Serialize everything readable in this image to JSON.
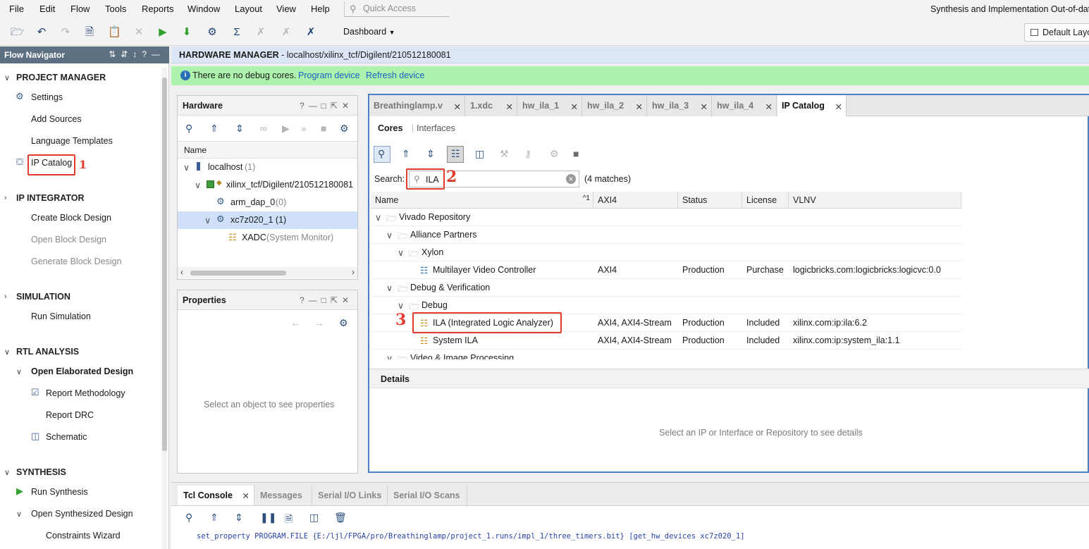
{
  "menu": [
    "File",
    "Edit",
    "Flow",
    "Tools",
    "Reports",
    "Window",
    "Layout",
    "View",
    "Help"
  ],
  "quick_access": {
    "placeholder": "Quick Access"
  },
  "window_status": "Synthesis and Implementation Out-of-date",
  "toolbar": {
    "dashboard_label": "Dashboard",
    "layout_label": "Default Layo"
  },
  "flow_navigator": {
    "title": "Flow Navigator",
    "sections": {
      "project_manager": "PROJECT MANAGER",
      "ip_integrator": "IP INTEGRATOR",
      "simulation": "SIMULATION",
      "rtl_analysis": "RTL ANALYSIS",
      "synthesis": "SYNTHESIS"
    },
    "items": {
      "settings": "Settings",
      "add_sources": "Add Sources",
      "language_templates": "Language Templates",
      "ip_catalog": "IP Catalog",
      "create_block_design": "Create Block Design",
      "open_block_design": "Open Block Design",
      "generate_block_design": "Generate Block Design",
      "run_simulation": "Run Simulation",
      "open_elaborated_design": "Open Elaborated Design",
      "report_methodology": "Report Methodology",
      "report_drc": "Report DRC",
      "schematic": "Schematic",
      "run_synthesis": "Run Synthesis",
      "open_synthesized_design": "Open Synthesized Design",
      "constraints_wizard": "Constraints Wizard"
    }
  },
  "annotations": {
    "one": "1",
    "two": "2",
    "three": "3"
  },
  "hardware_manager": {
    "title_bold": "HARDWARE MANAGER",
    "title_rest": " - localhost/xilinx_tcf/Digilent/210512180081",
    "info": "There are no debug cores.",
    "link_program": "Program device",
    "link_refresh": "Refresh device"
  },
  "hardware_panel": {
    "title": "Hardware",
    "col_name": "Name",
    "rows": {
      "localhost": "localhost",
      "localhost_count": " (1)",
      "target": "xilinx_tcf/Digilent/210512180081",
      "arm": "arm_dap_0",
      "arm_count": " (0)",
      "device": "xc7z020_1 (1)",
      "xadc": "XADC",
      "xadc_suffix": " (System Monitor)"
    }
  },
  "properties_panel": {
    "title": "Properties",
    "empty": "Select an object to see properties"
  },
  "ip_catalog": {
    "tabs": [
      "Breathinglamp.v",
      "1.xdc",
      "hw_ila_1",
      "hw_ila_2",
      "hw_ila_3",
      "hw_ila_4",
      "IP Catalog"
    ],
    "subtabs": {
      "cores": "Cores",
      "interfaces": "Interfaces"
    },
    "search_label": "Search:",
    "search_value": "ILA",
    "matches": "(4 matches)",
    "columns": {
      "name": "Name",
      "sort": "^1",
      "axi4": "AXI4",
      "status": "Status",
      "license": "License",
      "vlnv": "VLNV"
    },
    "rows": {
      "vivado_repo": "Vivado Repository",
      "alliance": "Alliance Partners",
      "xylon": "Xylon",
      "mvc": {
        "name": "Multilayer Video Controller",
        "axi4": "AXI4",
        "status": "Production",
        "license": "Purchase",
        "vlnv": "logicbricks.com:logicbricks:logicvc:0.0"
      },
      "debug_ver": "Debug & Verification",
      "debug": "Debug",
      "ila": {
        "name": "ILA (Integrated Logic Analyzer)",
        "axi4": "AXI4, AXI4-Stream",
        "status": "Production",
        "license": "Included",
        "vlnv": "xilinx.com:ip:ila:6.2"
      },
      "system_ila": {
        "name": "System ILA",
        "axi4": "AXI4, AXI4-Stream",
        "status": "Production",
        "license": "Included",
        "vlnv": "xilinx.com:ip:system_ila:1.1"
      },
      "video": "Video & Image Processing"
    },
    "details_title": "Details",
    "details_empty": "Select an IP or Interface or Repository to see details"
  },
  "console": {
    "tabs": [
      "Tcl Console",
      "Messages",
      "Serial I/O Links",
      "Serial I/O Scans"
    ],
    "line1": "set_property PROGRAM.FILE {E:/ljl/FPGA/pro/Breathinglamp/project_1.runs/impl_1/three_timers.bit} [get_hw_devices xc7z020_1]"
  },
  "colors": {
    "accent": "#4a80c8",
    "annotation": "#e23b2f",
    "nav_header": "#5c7081",
    "info_bar": "#adf3ad"
  }
}
